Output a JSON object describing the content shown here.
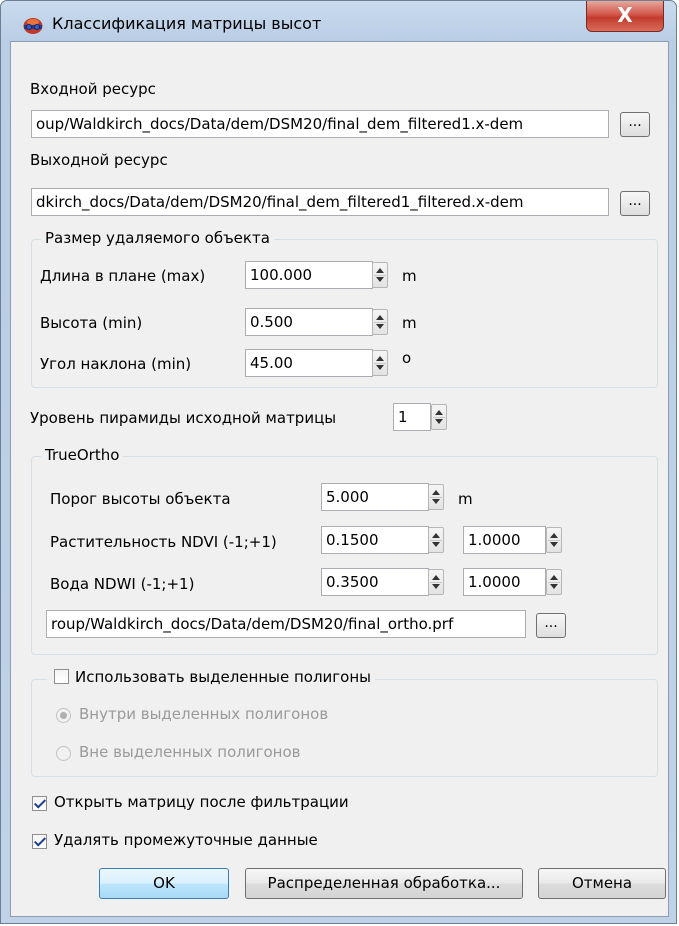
{
  "window": {
    "title": "Классификация матрицы высот",
    "close_glyph": "X"
  },
  "input": {
    "label": "Входной ресурс",
    "value": "oup/Waldkirch_docs/Data/dem/DSM20/final_dem_filtered1.x-dem",
    "browse_label": "..."
  },
  "output": {
    "label": "Выходной ресурс",
    "value": "dkirch_docs/Data/dem/DSM20/final_dem_filtered1_filtered.x-dem",
    "browse_label": "..."
  },
  "object_size": {
    "title": "Размер удаляемого объекта",
    "length_label": "Длина в плане (max)",
    "length_value": "100.000",
    "length_unit": "m",
    "height_label": "Высота (min)",
    "height_value": "0.500",
    "height_unit": "m",
    "slope_label": "Угол наклона (min)",
    "slope_value": "45.00",
    "slope_unit": "о"
  },
  "pyramid": {
    "label": "Уровень пирамиды исходной матрицы",
    "value": "1"
  },
  "trueortho": {
    "title": "TrueOrtho",
    "threshold_label": "Порог высоты объекта",
    "threshold_value": "5.000",
    "threshold_unit": "m",
    "ndvi_label": "Растительность NDVI (-1;+1)",
    "ndvi_min": "0.1500",
    "ndvi_max": "1.0000",
    "ndwi_label": "Вода NDWI (-1;+1)",
    "ndwi_min": "0.3500",
    "ndwi_max": "1.0000",
    "ortho_path": "roup/Waldkirch_docs/Data/dem/DSM20/final_ortho.prf",
    "browse_label": "..."
  },
  "polygons": {
    "checkbox_label": "Использовать выделенные полигоны",
    "checked": false,
    "inside_label": "Внутри выделенных полигонов",
    "outside_label": "Вне выделенных полигонов"
  },
  "open_after": {
    "label": "Открыть матрицу после фильтрации",
    "checked": true
  },
  "delete_temp": {
    "label": "Удалять промежуточные данные",
    "checked": true
  },
  "buttons": {
    "ok": "OK",
    "distributed": "Распределенная обработка...",
    "cancel": "Отмена"
  }
}
